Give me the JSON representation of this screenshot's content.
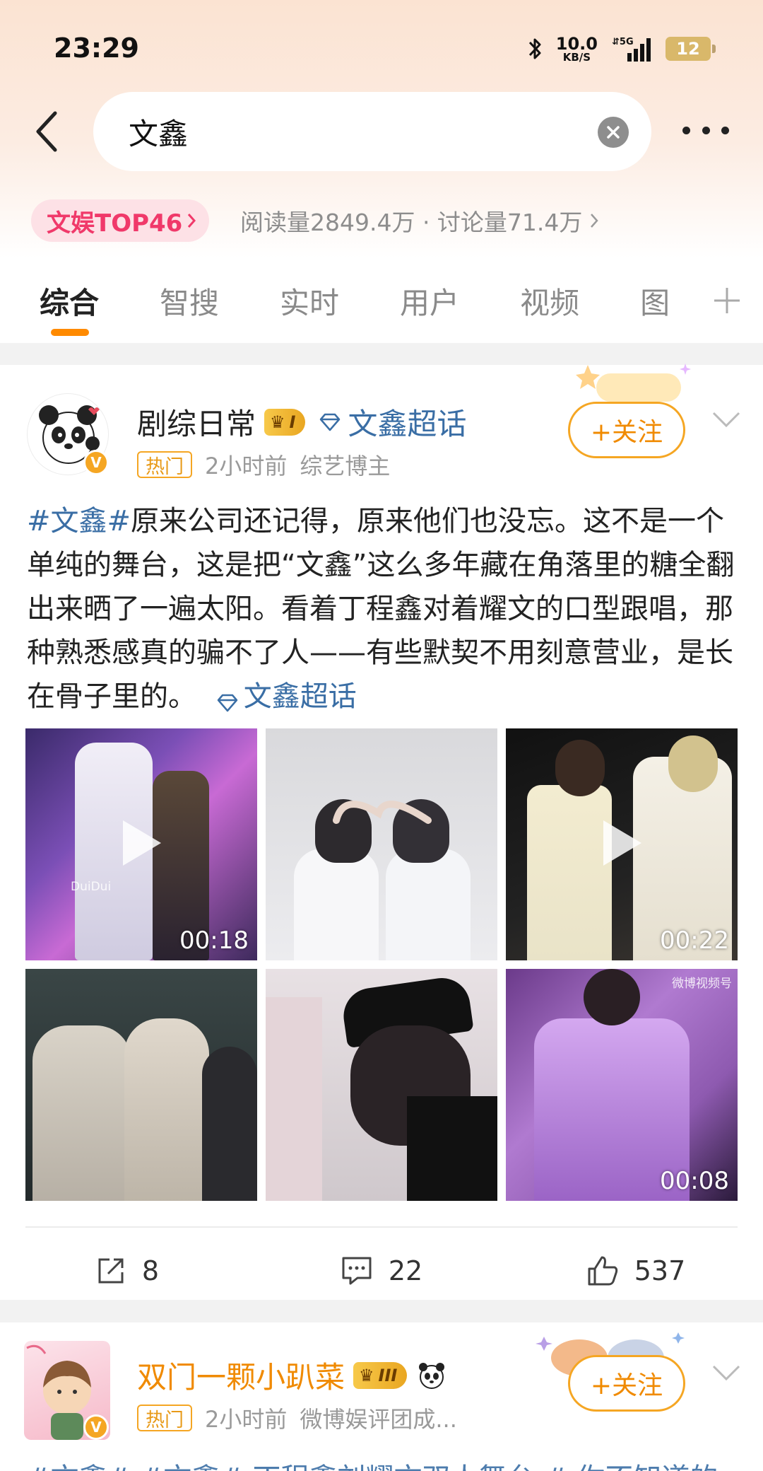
{
  "status_bar": {
    "time": "23:29",
    "net_speed": "10.0",
    "net_unit": "KB/S",
    "network": "5G",
    "battery": "12"
  },
  "search": {
    "query": "文鑫"
  },
  "hot": {
    "rank_label": "文娱TOP46",
    "stats": "阅读量2849.4万 · 讨论量71.4万"
  },
  "tabs": [
    {
      "label": "综合",
      "active": true
    },
    {
      "label": "智搜"
    },
    {
      "label": "实时"
    },
    {
      "label": "用户"
    },
    {
      "label": "视频"
    },
    {
      "label": "图"
    }
  ],
  "post": {
    "author": "剧综日常",
    "level_badge": "I",
    "supertopic": "文鑫超话",
    "hot_tag": "热门",
    "time": "2小时前",
    "role": "综艺博主",
    "follow_label": "+关注",
    "hashtag": "#文鑫#",
    "text": "原来公司还记得，原来他们也没忘。这不是一个单纯的舞台，这是把“文鑫”这么多年藏在角落里的糖全翻出来晒了一遍太阳。看着丁程鑫对着耀文的口型跟唱，那种熟悉感真的骗不了人——有些默契不用刻意营业，是长在骨子里的。",
    "inline_supertopic": "文鑫超话",
    "media": [
      {
        "duration": "00:18",
        "video": true,
        "watermark": "DuiDui"
      },
      {
        "duration": "",
        "video": false
      },
      {
        "duration": "00:22",
        "video": true
      },
      {
        "duration": "",
        "video": false
      },
      {
        "duration": "",
        "video": false
      },
      {
        "duration": "00:08",
        "video": false,
        "watermark": "微博视频号"
      }
    ],
    "reposts": "8",
    "comments": "22",
    "likes": "537"
  },
  "post2": {
    "author": "双门一颗小趴菜",
    "level_badge": "III",
    "hot_tag": "热门",
    "time": "2小时前",
    "role": "微博娱评团成...",
    "follow_label": "+关注",
    "peek_text": "#文鑫# #文鑫# 丁程鑫刘耀文双人舞台 # 你不知道的"
  },
  "colors": {
    "accent": "#f5a623",
    "link": "#3a6ea5",
    "rank": "#f0396a"
  }
}
